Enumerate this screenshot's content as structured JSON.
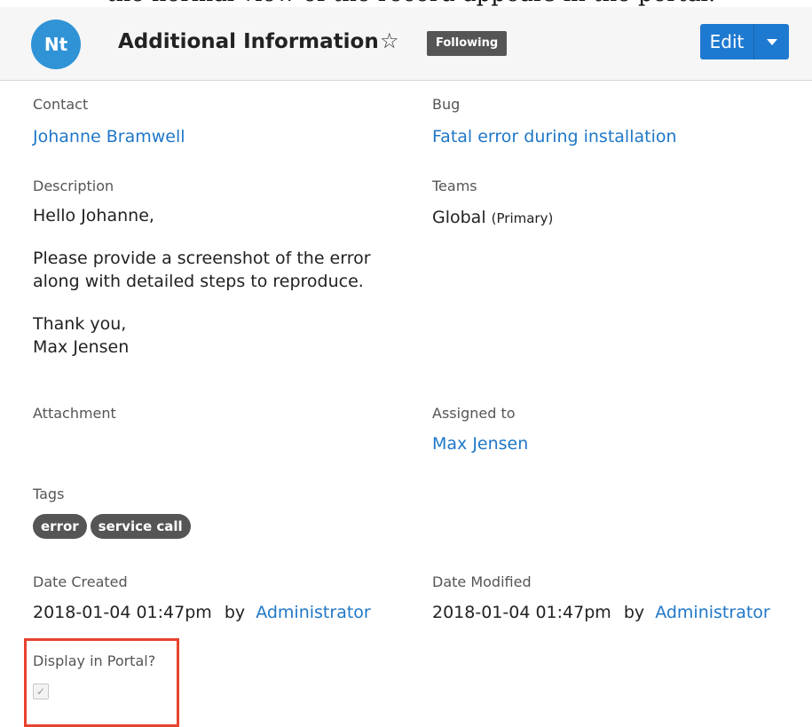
{
  "header": {
    "avatar_initials": "Nt",
    "title": "Additional Information",
    "star_glyph": "☆",
    "following_label": "Following",
    "edit_label": "Edit",
    "accent_color": "#1e7ad1"
  },
  "fields": {
    "contact": {
      "label": "Contact",
      "value": "Johanne Bramwell"
    },
    "bug": {
      "label": "Bug",
      "value": "Fatal error during installation"
    },
    "description": {
      "label": "Description",
      "lines": [
        "Hello Johanne,",
        "Please provide a screenshot of the error",
        "along with detailed steps to reproduce.",
        "Thank you,",
        "Max Jensen"
      ]
    },
    "teams": {
      "label": "Teams",
      "value": "Global",
      "suffix": "(Primary)"
    },
    "attachment": {
      "label": "Attachment"
    },
    "assigned_to": {
      "label": "Assigned to",
      "value": "Max Jensen"
    },
    "tags": {
      "label": "Tags",
      "items": [
        "error",
        "service call"
      ]
    },
    "date_created": {
      "label": "Date Created",
      "value": "2018-01-04 01:47pm",
      "by": "by",
      "user": "Administrator"
    },
    "date_modified": {
      "label": "Date Modified",
      "value": "2018-01-04 01:47pm",
      "by": "by",
      "user": "Administrator"
    },
    "display_in_portal": {
      "label": "Display in Portal?",
      "checked": true,
      "check_glyph": "✓"
    }
  },
  "caption": {
    "text": "the normal view of the record appears in the portal."
  }
}
